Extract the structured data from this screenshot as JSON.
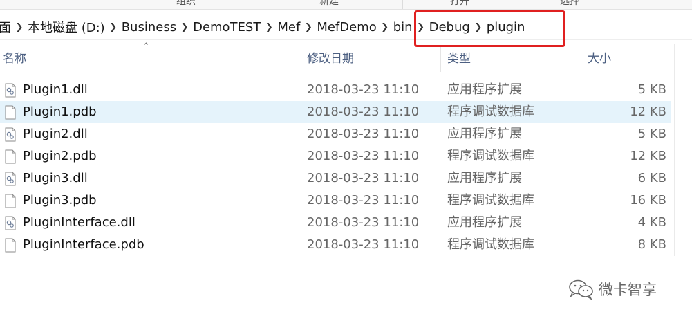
{
  "ribbon": {
    "groups": [
      "组织",
      "新建",
      "打开",
      "选择"
    ]
  },
  "address_bar": {
    "crumbs": [
      "面",
      "本地磁盘 (D:)",
      "Business",
      "DemoTEST",
      "Mef",
      "MefDemo",
      "bin",
      "Debug",
      "plugin"
    ],
    "highlight_color": "#e02020"
  },
  "columns": {
    "name": "名称",
    "date": "修改日期",
    "type": "类型",
    "size": "大小"
  },
  "files": [
    {
      "name": "Plugin1.dll",
      "date": "2018-03-23 11:10",
      "type": "应用程序扩展",
      "size": "5 KB",
      "icon": "dll-icon",
      "selected": false
    },
    {
      "name": "Plugin1.pdb",
      "date": "2018-03-23 11:10",
      "type": "程序调试数据库",
      "size": "12 KB",
      "icon": "file-icon",
      "selected": true
    },
    {
      "name": "Plugin2.dll",
      "date": "2018-03-23 11:10",
      "type": "应用程序扩展",
      "size": "5 KB",
      "icon": "dll-icon",
      "selected": false
    },
    {
      "name": "Plugin2.pdb",
      "date": "2018-03-23 11:10",
      "type": "程序调试数据库",
      "size": "12 KB",
      "icon": "file-icon",
      "selected": false
    },
    {
      "name": "Plugin3.dll",
      "date": "2018-03-23 11:10",
      "type": "应用程序扩展",
      "size": "6 KB",
      "icon": "dll-icon",
      "selected": false
    },
    {
      "name": "Plugin3.pdb",
      "date": "2018-03-23 11:10",
      "type": "程序调试数据库",
      "size": "16 KB",
      "icon": "file-icon",
      "selected": false
    },
    {
      "name": "PluginInterface.dll",
      "date": "2018-03-23 11:10",
      "type": "应用程序扩展",
      "size": "4 KB",
      "icon": "dll-icon",
      "selected": false
    },
    {
      "name": "PluginInterface.pdb",
      "date": "2018-03-23 11:10",
      "type": "程序调试数据库",
      "size": "8 KB",
      "icon": "file-icon",
      "selected": false
    }
  ],
  "colors": {
    "selection": "#e5f3fb",
    "header_text": "#4d6082"
  },
  "watermark": {
    "text": "微卡智享",
    "icon": "wechat-icon"
  }
}
